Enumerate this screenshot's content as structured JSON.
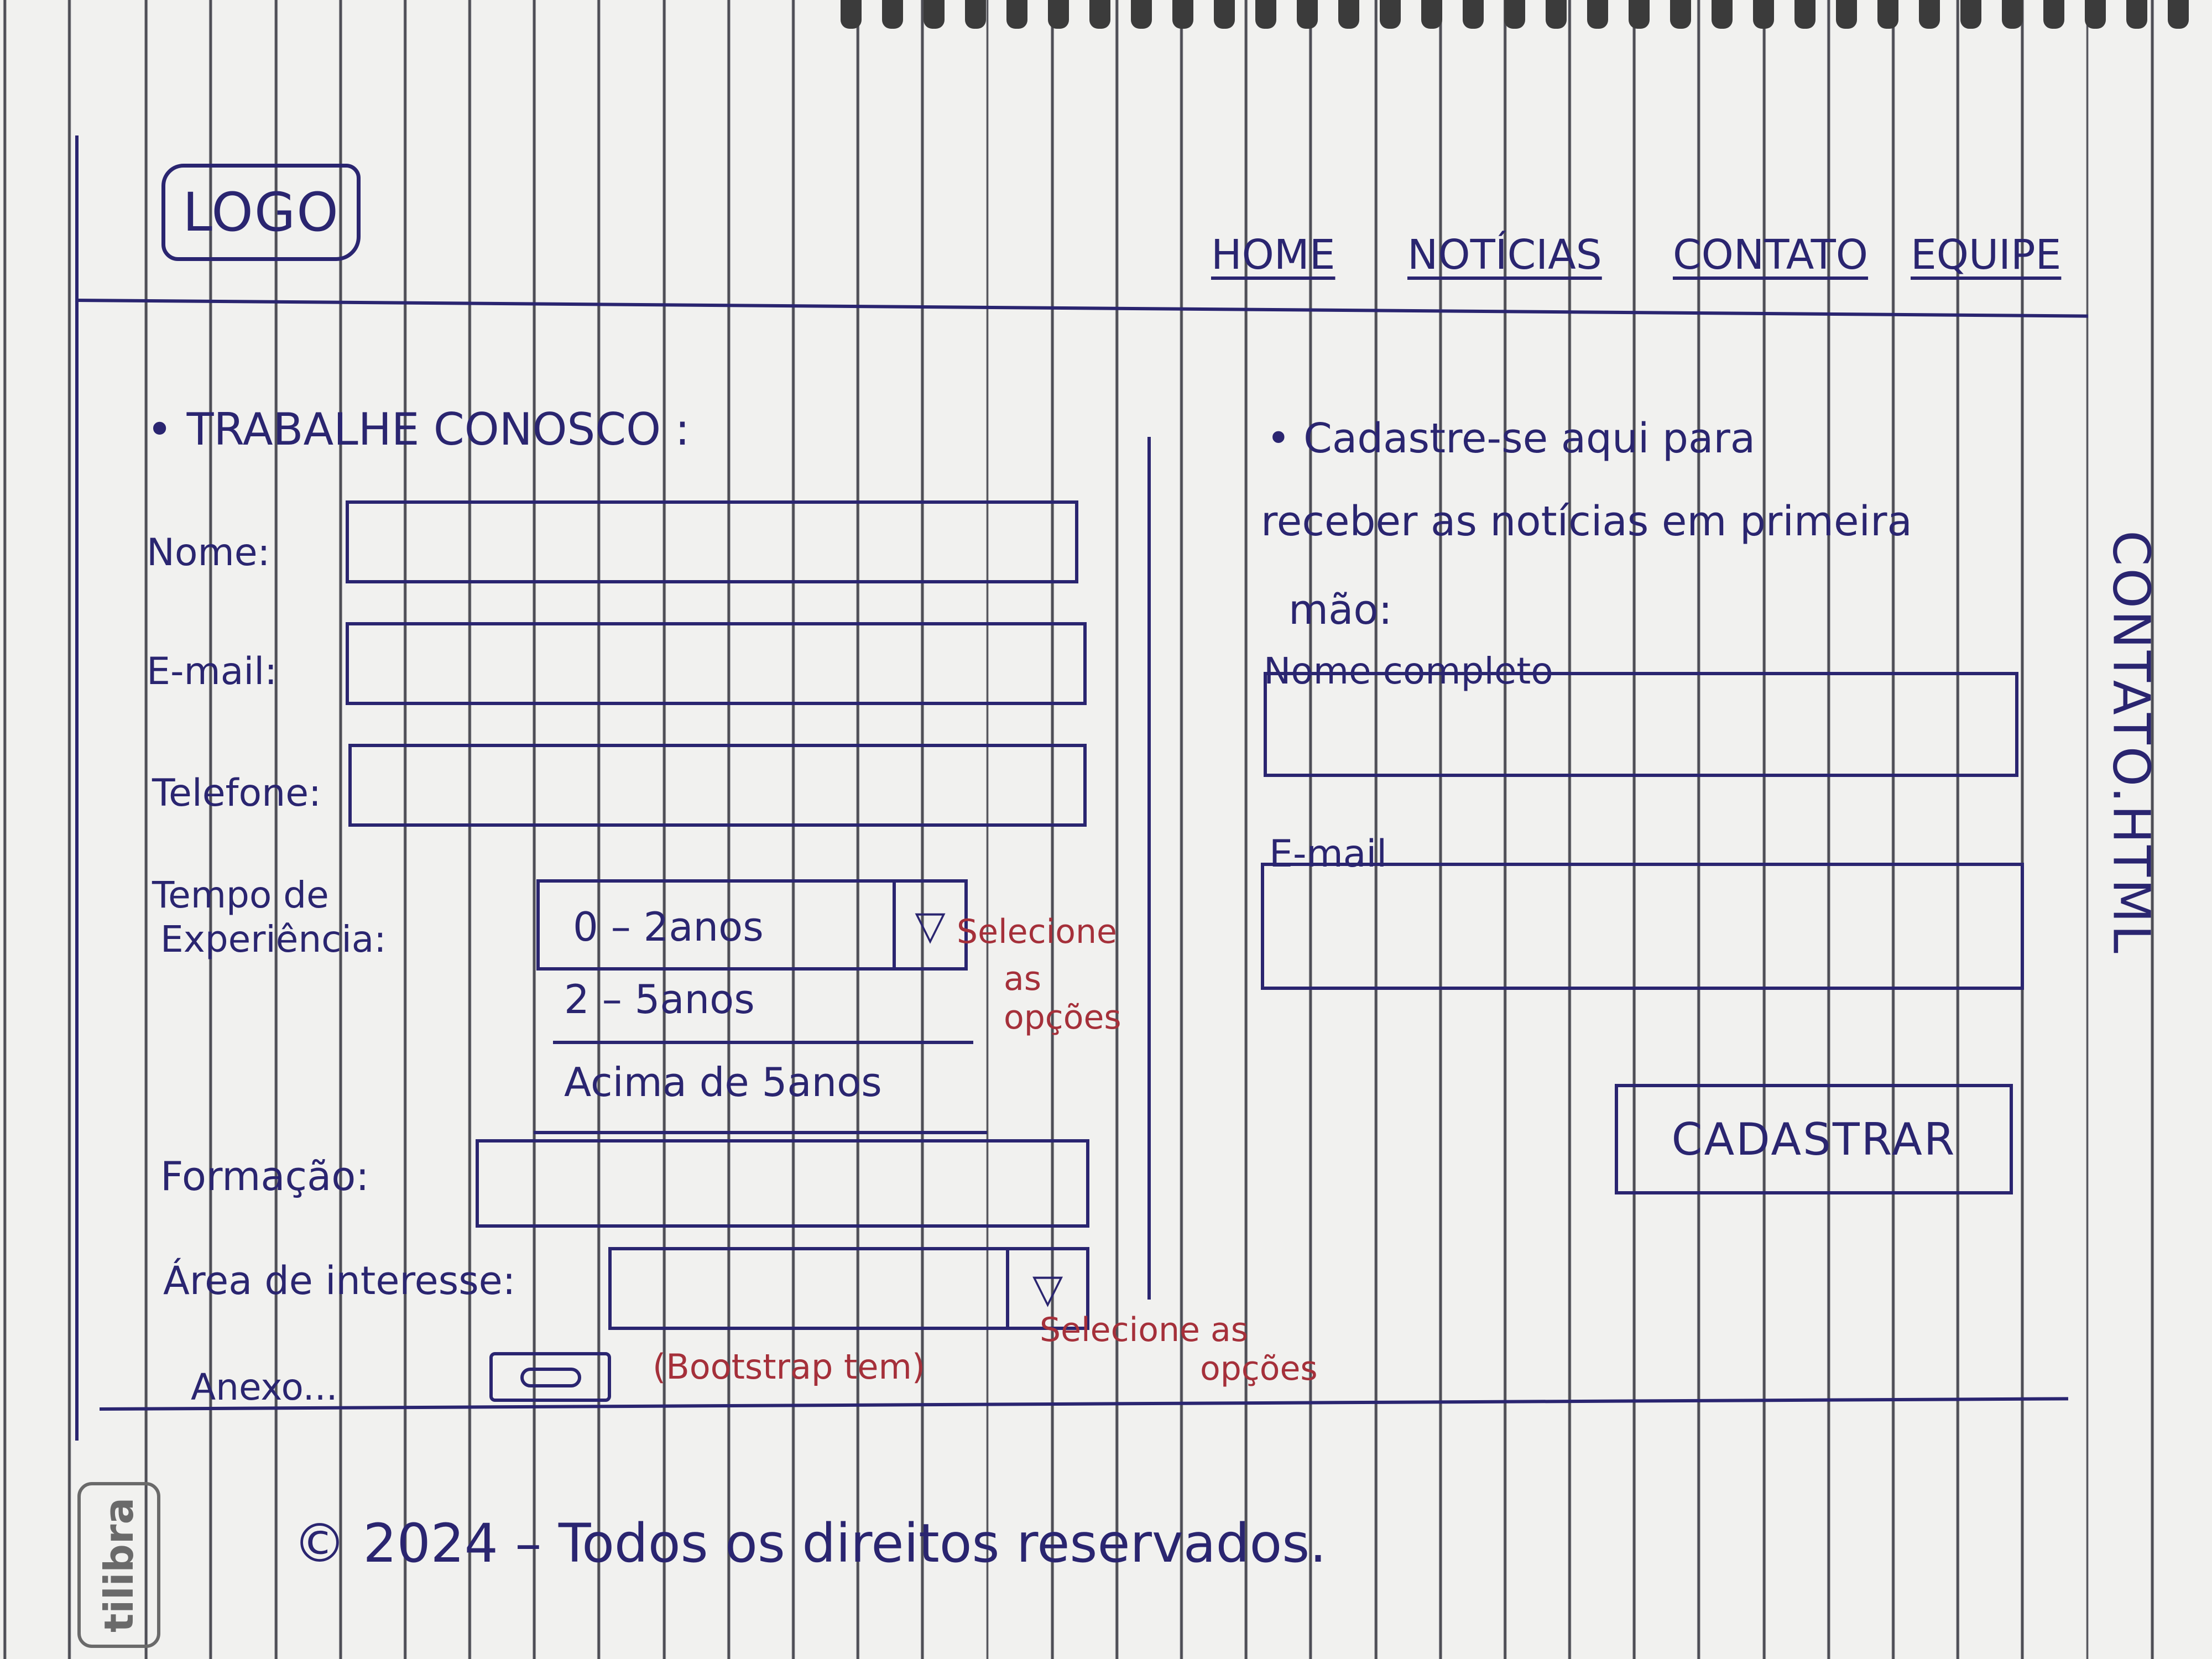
{
  "header": {
    "logo": "LOGO",
    "nav": [
      "HOME",
      "NOTÍCIAS",
      "CONTATO",
      "EQUIPE"
    ]
  },
  "work_form": {
    "title": "• TRABALHE CONOSCO :",
    "name_label": "Nome:",
    "email_label": "E-mail:",
    "phone_label": "Telefone:",
    "experience_label_1": "Tempo de",
    "experience_label_2": "Experiência:",
    "experience_selected": "0 – 2anos",
    "experience_options": [
      "2 – 5anos",
      "Acima de 5anos"
    ],
    "experience_note": [
      "Selecione",
      "as",
      "opções"
    ],
    "education_label": "Formação:",
    "interest_label": "Área de interesse:",
    "interest_note": [
      "Selecione as",
      "opções"
    ],
    "attachment_label": "Anexo...",
    "attachment_note": "(Bootstrap tem)",
    "select_arrow": "▽"
  },
  "newsletter": {
    "intro_1": "• Cadastre-se aqui para",
    "intro_2": "receber as notícias em primeira",
    "intro_3": "mão:",
    "name_label": "Nome completo",
    "email_label": "E-mail",
    "submit_label": "CADASTRAR"
  },
  "side_note": "CONTATO.HTML",
  "footer": {
    "copyright": "© 2024 – Todos os direitos reservados."
  },
  "notebook_brand": "tilibra"
}
